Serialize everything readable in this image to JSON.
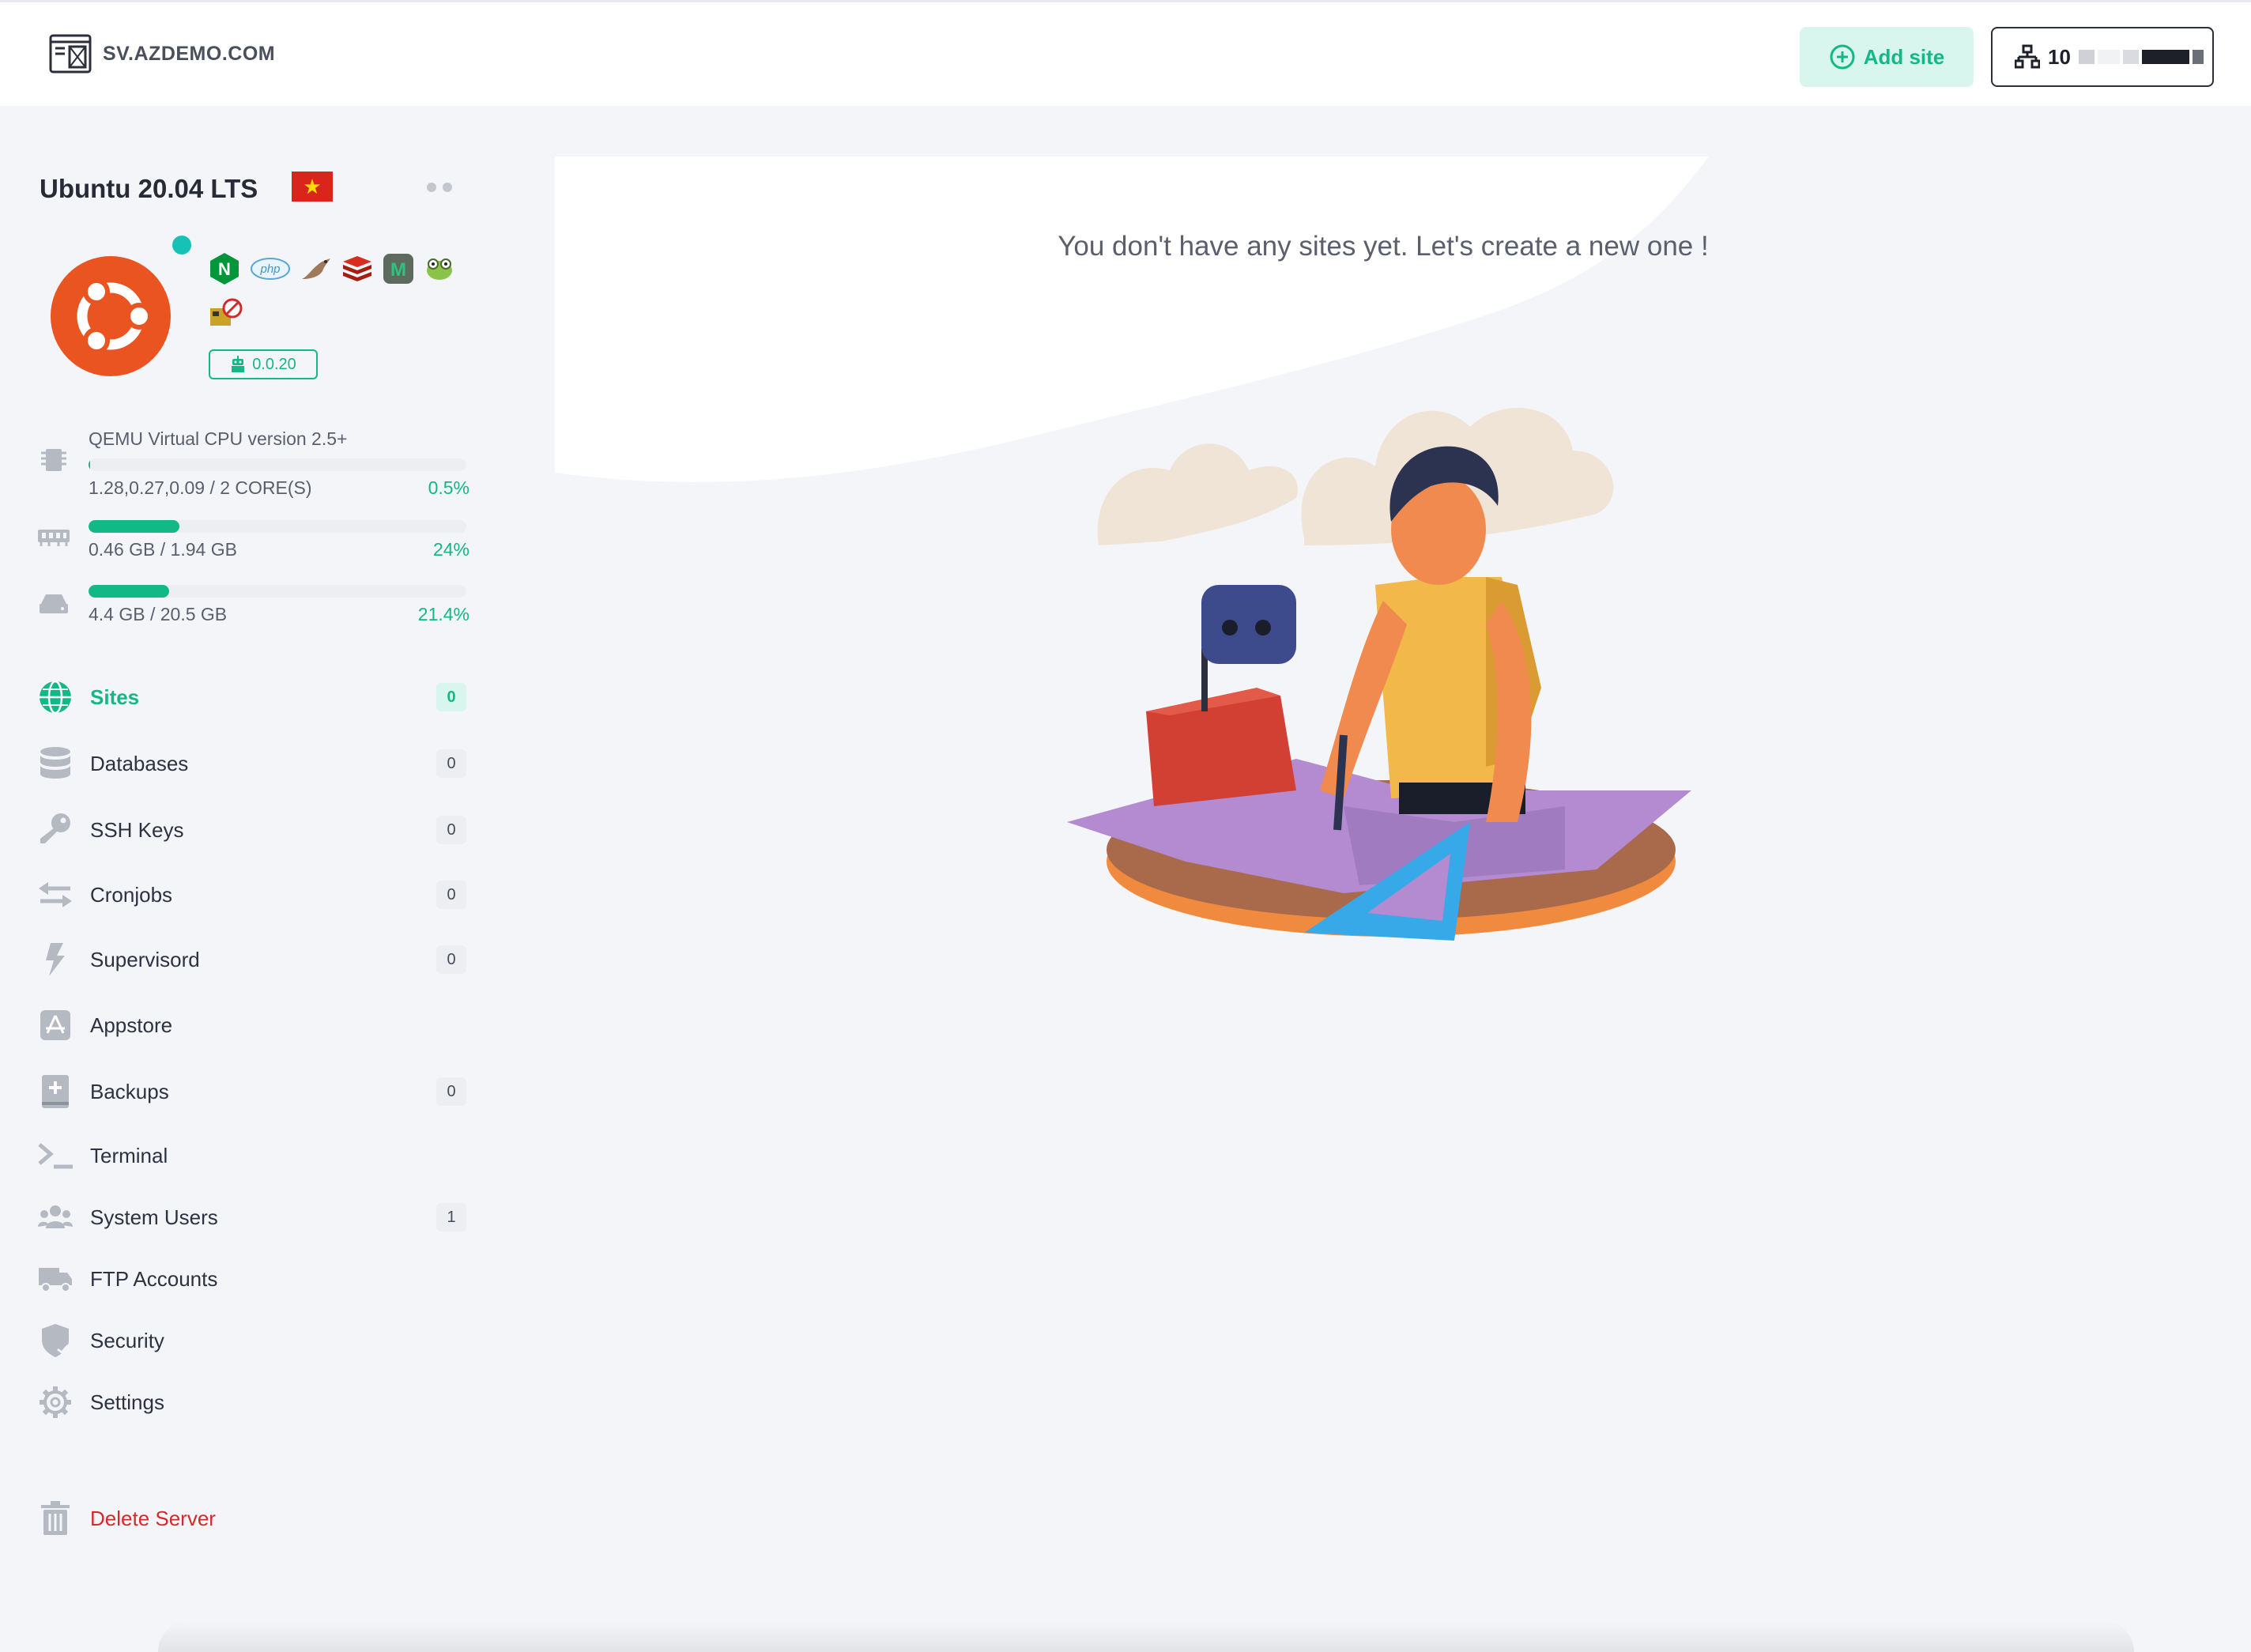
{
  "header": {
    "site_name": "SV.AZDEMO.COM",
    "add_site_label": "Add site",
    "ip_visible": "10"
  },
  "server": {
    "os_name": "Ubuntu 20.04 LTS",
    "agent_version": "0.0.20",
    "stack_icons": [
      "nginx-icon",
      "php-icon",
      "mariadb-icon",
      "redis-icon",
      "memcached-icon",
      "frog-icon",
      "fail2ban-icon"
    ]
  },
  "metrics": {
    "cpu": {
      "title": "QEMU Virtual CPU version 2.5+",
      "detail": "1.28,0.27,0.09 / 2 CORE(S)",
      "percent_label": "0.5%",
      "percent": 0.5
    },
    "ram": {
      "detail": "0.46 GB / 1.94 GB",
      "percent_label": "24%",
      "percent": 24
    },
    "disk": {
      "detail": "4.4 GB / 20.5 GB",
      "percent_label": "21.4%",
      "percent": 21.4
    }
  },
  "nav": {
    "sites": {
      "label": "Sites",
      "count": "0"
    },
    "databases": {
      "label": "Databases",
      "count": "0"
    },
    "ssh_keys": {
      "label": "SSH Keys",
      "count": "0"
    },
    "cronjobs": {
      "label": "Cronjobs",
      "count": "0"
    },
    "supervisord": {
      "label": "Supervisord",
      "count": "0"
    },
    "appstore": {
      "label": "Appstore"
    },
    "backups": {
      "label": "Backups",
      "count": "0"
    },
    "terminal": {
      "label": "Terminal"
    },
    "system_users": {
      "label": "System Users",
      "count": "1"
    },
    "ftp_accounts": {
      "label": "FTP Accounts"
    },
    "security": {
      "label": "Security"
    },
    "settings": {
      "label": "Settings"
    },
    "delete_server": {
      "label": "Delete Server"
    }
  },
  "main": {
    "empty_message": "You don't have any sites yet. Let's create a new one !"
  },
  "colors": {
    "accent": "#12b886",
    "danger": "#d6292b",
    "ubuntu": "#e95420"
  }
}
